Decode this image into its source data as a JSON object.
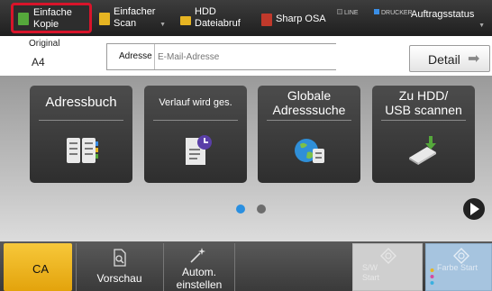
{
  "topbar": {
    "tabs": [
      {
        "label": "Einfache\nKopie",
        "active": true,
        "icon": "copy-icon"
      },
      {
        "label": "Einfacher\nScan",
        "icon": "scan-icon"
      },
      {
        "label": "HDD\nDateiabruf",
        "icon": "folder-icon"
      },
      {
        "label": "Sharp OSA",
        "icon": "osa-icon"
      }
    ],
    "leds": [
      {
        "label": "LINE",
        "color": "#444444"
      },
      {
        "label": "DRUCKER",
        "color": "#3a8ee6"
      }
    ],
    "job_status": "Auftragsstatus"
  },
  "info": {
    "original_label": "Original",
    "original_value": "A4",
    "address_label": "Adresse",
    "address_placeholder": "E-Mail-Adresse",
    "detail_label": "Detail"
  },
  "cards": [
    {
      "label": "Adressbuch",
      "icon": "address-book-icon"
    },
    {
      "label": "Verlauf wird ges.",
      "icon": "history-icon"
    },
    {
      "label": "Globale\nAdresssuche",
      "icon": "global-search-icon"
    },
    {
      "label": "Zu HDD/\nUSB scannen",
      "icon": "usb-scan-icon"
    }
  ],
  "pagination": {
    "current": 1,
    "total": 2
  },
  "bottombar": {
    "ca_label": "CA",
    "preview_label": "Vorschau",
    "auto_label": "Autom.\neinstellen",
    "sw_start_label": "S/W\nStart",
    "color_start_label": "Farbe\nStart"
  },
  "colors": {
    "accent_highlight": "#d8142a",
    "ca_button": "#f0b41e",
    "page_dot_active": "#2a8fe0"
  }
}
